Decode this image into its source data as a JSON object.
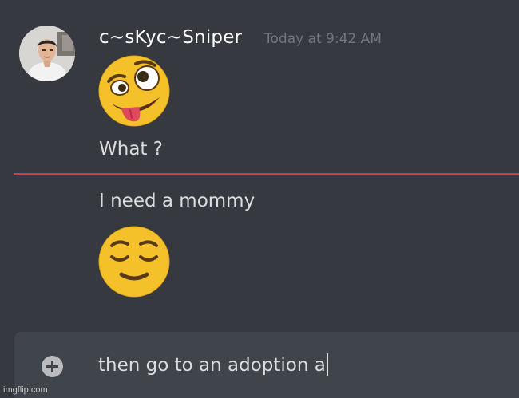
{
  "message": {
    "author": "c~sKyc~Sniper",
    "timestamp": "Today at 9:42 AM",
    "lines": [
      {
        "emoji": "zany-face-emoji",
        "text": "What  ?"
      },
      {
        "text": "I need a mommy",
        "emoji": "relieved-face-emoji"
      }
    ]
  },
  "composer": {
    "value": "then go to an adoption a",
    "attach_icon": "plus-circle-icon"
  },
  "watermark": "imgflip.com",
  "colors": {
    "background": "#36393f",
    "composer": "#40444b",
    "new_messages_divider": "#c9403f",
    "username": "#ffffff",
    "text": "#dcddde",
    "timestamp": "#72767d"
  }
}
